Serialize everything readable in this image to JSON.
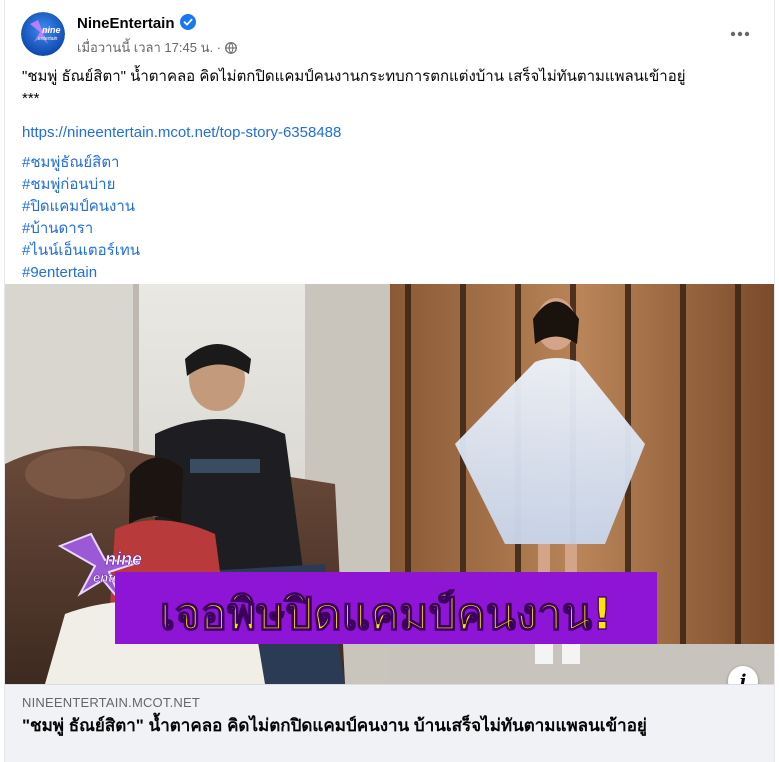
{
  "post": {
    "page_name": "NineEntertain",
    "timestamp": "เมื่อวานนี้ เวลา 17:45 น. ·",
    "text_line1": "\"ชมพู่ ธัณย์สิตา\" น้ำตาคลอ คิดไม่ตกปิดแคมป์คนงานกระทบการตกแต่งบ้าน เสร็จไม่ทันตามแพลนเข้าอยู่",
    "text_line2": "***",
    "url": "https://nineentertain.mcot.net/top-story-6358488",
    "hashtags": [
      "#ชมพู่ธัณย์สิตา",
      "#ชมพู่ก่อนบ่าย",
      "#ปิดแคมป์คนงาน",
      "#บ้านดารา",
      "#ไนน์เอ็นเตอร์เทน",
      "#9entertain"
    ],
    "icons": {
      "verified": "verified-badge-icon",
      "audience": "globe-icon",
      "more": "more-options-icon"
    }
  },
  "media": {
    "logo_line1": "nine",
    "logo_line2": "entertain",
    "banner_text": "เจอพิษปิดแคมป์คนงาน!",
    "info_glyph": "i"
  },
  "avatar": {
    "line1": "nine",
    "line2": "entertain"
  },
  "link_preview": {
    "domain": "NINEENTERTAIN.MCOT.NET",
    "title": "\"ชมพู่ ธัณย์สิตา\" น้ำตาคลอ คิดไม่ตกปิดแคมป์คนงาน บ้านเสร็จไม่ทันตามแพลนเข้าอยู่"
  },
  "colors": {
    "link": "#216fdb",
    "verified": "#1877f2",
    "banner_bg": "#8e14d6",
    "banner_text": "#ffe400",
    "logo_purple": "#7a2cc7",
    "secondary_text": "#65676b",
    "preview_bg": "#f0f2f5"
  }
}
